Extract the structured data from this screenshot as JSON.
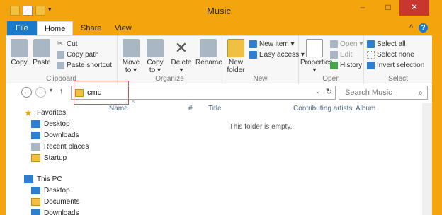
{
  "window": {
    "title": "Music"
  },
  "titlebar": {
    "minimize": "–",
    "maximize": "□",
    "close": "✕"
  },
  "tabs": {
    "file": "File",
    "home": "Home",
    "share": "Share",
    "view": "View",
    "collapse": "^",
    "help": "?"
  },
  "ribbon": {
    "clipboard": {
      "label": "Clipboard",
      "copy": "Copy",
      "paste": "Paste",
      "cut": "Cut",
      "copy_path": "Copy path",
      "paste_shortcut": "Paste shortcut"
    },
    "organize": {
      "label": "Organize",
      "move_to": "Move to ▾",
      "copy_to": "Copy to ▾",
      "delete": "Delete",
      "delete_arrow": "▾",
      "rename": "Rename"
    },
    "new": {
      "label": "New",
      "new_folder": "New folder",
      "new_item": "New item ▾",
      "easy_access": "Easy access ▾"
    },
    "open": {
      "label": "Open",
      "properties": "Properties",
      "properties_arrow": "▾",
      "open": "Open ▾",
      "edit": "Edit",
      "history": "History"
    },
    "select": {
      "label": "Select",
      "select_all": "Select all",
      "select_none": "Select none",
      "invert_selection": "Invert selection"
    }
  },
  "address": {
    "back": "←",
    "forward": "→",
    "up": "↑",
    "path": "cmd",
    "dropdown": "⌄",
    "refresh": "↻"
  },
  "search": {
    "placeholder": "Search Music"
  },
  "nav": {
    "favorites": "Favorites",
    "desktop": "Desktop",
    "downloads": "Downloads",
    "recent_places": "Recent places",
    "startup": "Startup",
    "this_pc": "This PC",
    "pc_desktop": "Desktop",
    "pc_documents": "Documents",
    "pc_downloads": "Downloads"
  },
  "columns": {
    "name": "Name",
    "number": "#",
    "title": "Title",
    "contributing_artists": "Contributing artists",
    "album": "Album"
  },
  "content": {
    "empty_message": "This folder is empty."
  },
  "colors": {
    "accent": "#f4a40c",
    "file_tab": "#1979ca",
    "close": "#c7372f"
  }
}
